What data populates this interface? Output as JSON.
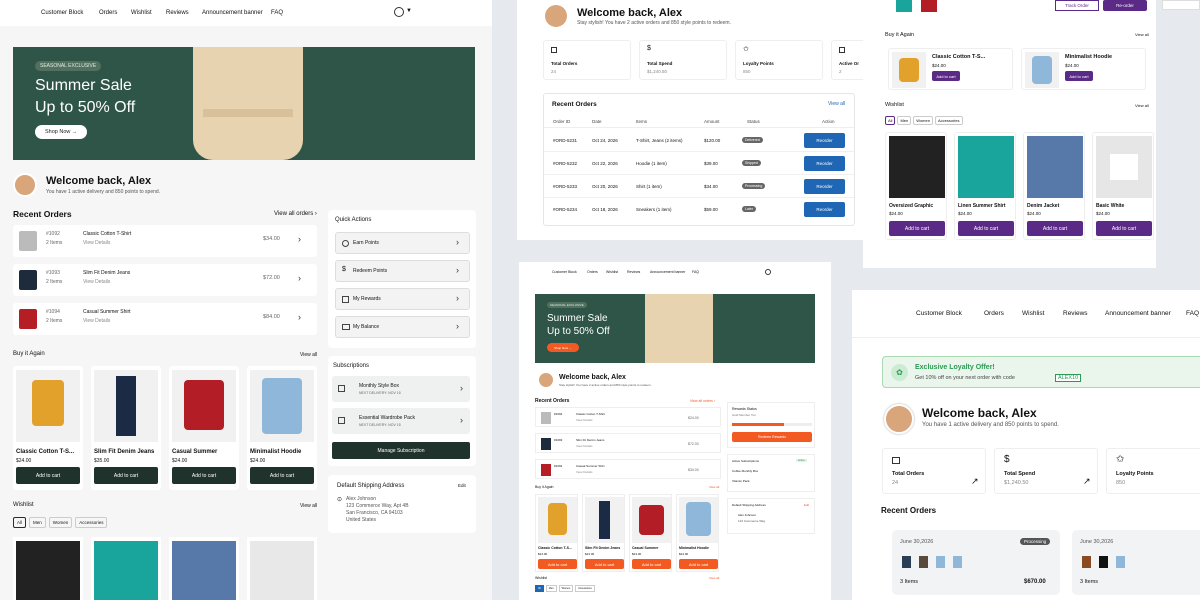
{
  "colors": {
    "dark_green": "#1f332c",
    "blue": "#1f66b4",
    "purple": "#5b2a86",
    "orange": "#f25a22",
    "bg": "#e6e9ee"
  },
  "nav": {
    "items": [
      "Customer Block",
      "Orders",
      "Wishlist",
      "Reviews",
      "Announcement banner",
      "FAQ"
    ]
  },
  "left": {
    "hero": {
      "badge": "SEASONAL EXCLUSIVE",
      "title1": "Summer Sale",
      "title2": "Up to 50% Off",
      "cta": "Shop Now →"
    },
    "welcome": {
      "title": "Welcome back, Alex",
      "subtitle": "You have 1 active delivery and 850 points to spend."
    },
    "orders": {
      "title": "Recent Orders",
      "view_all": "View all orders ›",
      "rows": [
        {
          "id": "#1092",
          "items": "2 Items",
          "name": "Classic Cotton T-Shirt",
          "link": "View Details",
          "price": "$34.00"
        },
        {
          "id": "#1093",
          "items": "2 Items",
          "name": "Slim Fit Denim Jeans",
          "link": "View Details",
          "price": "$72.00"
        },
        {
          "id": "#1094",
          "items": "2 Items",
          "name": "Casual Summer Shirt",
          "link": "View Details",
          "price": "$84.00"
        }
      ]
    },
    "quick": {
      "title": "Quick Actions",
      "items": [
        "Earn Points",
        "Redeem Points",
        "My Rewards",
        "My Balance"
      ]
    },
    "subs": {
      "title": "Subscriptions",
      "items": [
        {
          "name": "Monthly Style Box",
          "next": "NEXT DELIVERY: NOV 15"
        },
        {
          "name": "Essential Wardrobe Pack",
          "next": "NEXT DELIVERY: NOV 15"
        }
      ],
      "manage": "Manage Subscription"
    },
    "shipping": {
      "title": "Default Shipping Address",
      "edit": "Edit",
      "name": "Alex Johnson",
      "line1": "123 Commerce Way, Apt 4B",
      "line2": "San Francisco, CA 94103",
      "line3": "United States"
    },
    "buy_again": {
      "title": "Buy it Again",
      "view_all": "View all",
      "products": [
        {
          "name": "Classic Cotton T-S...",
          "price": "$24.00",
          "btn": "Add to cart"
        },
        {
          "name": "Slim Fit Denim Jeans",
          "price": "$35.00",
          "btn": "Add to cart"
        },
        {
          "name": "Casual Summer",
          "price": "$24.00",
          "btn": "Add to cart"
        },
        {
          "name": "Minimalist Hoodie",
          "price": "$24.00",
          "btn": "Add to cart"
        }
      ]
    },
    "wishlist": {
      "title": "Wishlist",
      "view_all": "View all",
      "filters": [
        "All",
        "Men",
        "Women",
        "Accessories"
      ]
    }
  },
  "mid_top": {
    "welcome": {
      "title": "Welcome back, Alex",
      "subtitle": "Stay stylish! You have 2 active orders and 850 style points to redeem."
    },
    "stats": [
      {
        "label": "Total Orders",
        "value": "24"
      },
      {
        "label": "Total Spend",
        "value": "$1,240.50"
      },
      {
        "label": "Loyalty Points",
        "value": "850"
      },
      {
        "label": "Active Or",
        "value": "2"
      }
    ],
    "orders": {
      "title": "Recent Orders",
      "view_all": "View all",
      "headers": [
        "Order ID",
        "Date",
        "Items",
        "Amount",
        "Status",
        "Action"
      ],
      "rows": [
        {
          "id": "#ORD-5231",
          "date": "Oct 24, 2026",
          "items": "T-Shirt, Jeans (2 items)",
          "amount": "$120.00",
          "status": "Delivered",
          "btn": "Reorder"
        },
        {
          "id": "#ORD-5232",
          "date": "Oct 22, 2026",
          "items": "Hoodie (1 item)",
          "amount": "$39.00",
          "status": "Shipped",
          "btn": "Reorder"
        },
        {
          "id": "#ORD-5233",
          "date": "Oct 20, 2026",
          "items": "Shirt (1 item)",
          "amount": "$34.00",
          "status": "Processing",
          "btn": "Reorder"
        },
        {
          "id": "#ORD-5234",
          "date": "Oct 18, 2026",
          "items": "Sneakers (1 item)",
          "amount": "$59.00",
          "status": "Later",
          "btn": "Reorder"
        }
      ]
    }
  },
  "right_top": {
    "track": "Track Order",
    "reorder": "Re-order",
    "buy_again": {
      "title": "Buy it Again",
      "view_all": "View all",
      "products": [
        {
          "name": "Classic Cotton T-S...",
          "price": "$24.00",
          "btn": "Add to cart"
        },
        {
          "name": "Minimalist Hoodie",
          "price": "$24.00",
          "btn": "Add to cart"
        }
      ]
    },
    "wishlist": {
      "title": "Wishlist",
      "view_all": "View all",
      "filters": [
        "All",
        "Men",
        "Women",
        "Accessories"
      ],
      "products": [
        {
          "name": "Oversized Graphic",
          "price": "$24.00",
          "btn": "Add to cart"
        },
        {
          "name": "Linen Summer Shirt",
          "price": "$24.00",
          "btn": "Add to cart"
        },
        {
          "name": "Denim Jacket",
          "price": "$24.00",
          "btn": "Add to cart"
        },
        {
          "name": "Basic White",
          "price": "$24.00",
          "btn": "Add to cart"
        }
      ]
    }
  },
  "mid_bottom": {
    "nav": [
      "Customer Block",
      "Orders",
      "Wishlist",
      "Reviews",
      "Announcement banner",
      "FAQ"
    ],
    "hero": {
      "badge": "SEASONAL EXCLUSIVE",
      "title1": "Summer Sale",
      "title2": "Up to 50% Off",
      "cta": "Shop Now →"
    },
    "welcome": {
      "title": "Welcome back, Alex",
      "subtitle": "Stay stylish! You have 2 active orders and 850 style points to redeem."
    },
    "orders": {
      "title": "Recent Orders",
      "view_all": "View all orders ›",
      "rows": [
        {
          "id": "#1092",
          "name": "Classic Cotton T-Shirt",
          "link": "View Details",
          "price": "$24.00"
        },
        {
          "id": "#1093",
          "name": "Slim Fit Denim Jeans",
          "link": "View Details",
          "price": "$72.00"
        },
        {
          "id": "#1094",
          "name": "Casual Summer Shirt",
          "link": "View Details",
          "price": "$34.00"
        }
      ]
    },
    "rewards": {
      "title": "Rewards Status",
      "sub": "Gold Member Tier",
      "btn": "Redeem Rewards"
    },
    "subs": {
      "title": "Active Subscriptions",
      "badge": "Active",
      "items": [
        "Coffee Monthly Box",
        "Vitamin Pack"
      ]
    },
    "shipping": {
      "title": "Default Shipping Address",
      "edit": "Edit",
      "name": "Alex Johnson",
      "line1": "123 Commerce Way"
    },
    "buy_again": {
      "title": "Buy it Again",
      "view_all": "View all",
      "products": [
        {
          "name": "Classic Cotton T-S...",
          "price": "$24.00",
          "btn": "Add to cart"
        },
        {
          "name": "Slim Fit Denim Jeans",
          "price": "$24.00",
          "btn": "Add to cart"
        },
        {
          "name": "Casual Summer",
          "price": "$24.00",
          "btn": "Add to cart"
        },
        {
          "name": "Minimalist Hoodie",
          "price": "$24.00",
          "btn": "Add to cart"
        }
      ]
    },
    "wishlist": {
      "title": "Wishlist",
      "view_all": "View all",
      "filters": [
        "All",
        "Men",
        "Women",
        "Accessories"
      ]
    }
  },
  "right_bottom": {
    "nav": [
      "Customer Block",
      "Orders",
      "Wishlist",
      "Reviews",
      "Announcement banner",
      "FAQ"
    ],
    "offer": {
      "title": "Exclusive Loyalty Offer!",
      "text": "Get 10% off on your next order with code",
      "code": "ALEX10"
    },
    "welcome": {
      "title": "Welcome back, Alex",
      "subtitle": "You have 1 active delivery and 850 points to spend."
    },
    "stats": [
      {
        "label": "Total Orders",
        "value": "24"
      },
      {
        "label": "Total Spend",
        "value": "$1,240.50"
      },
      {
        "label": "Loyalty Points",
        "value": "850"
      }
    ],
    "orders": {
      "title": "Recent Orders",
      "cards": [
        {
          "date": "June 30,2026",
          "status": "Processing",
          "items": "3 Items",
          "price": "$670.00"
        },
        {
          "date": "June 30,2026",
          "items": "3 Items"
        }
      ]
    }
  }
}
